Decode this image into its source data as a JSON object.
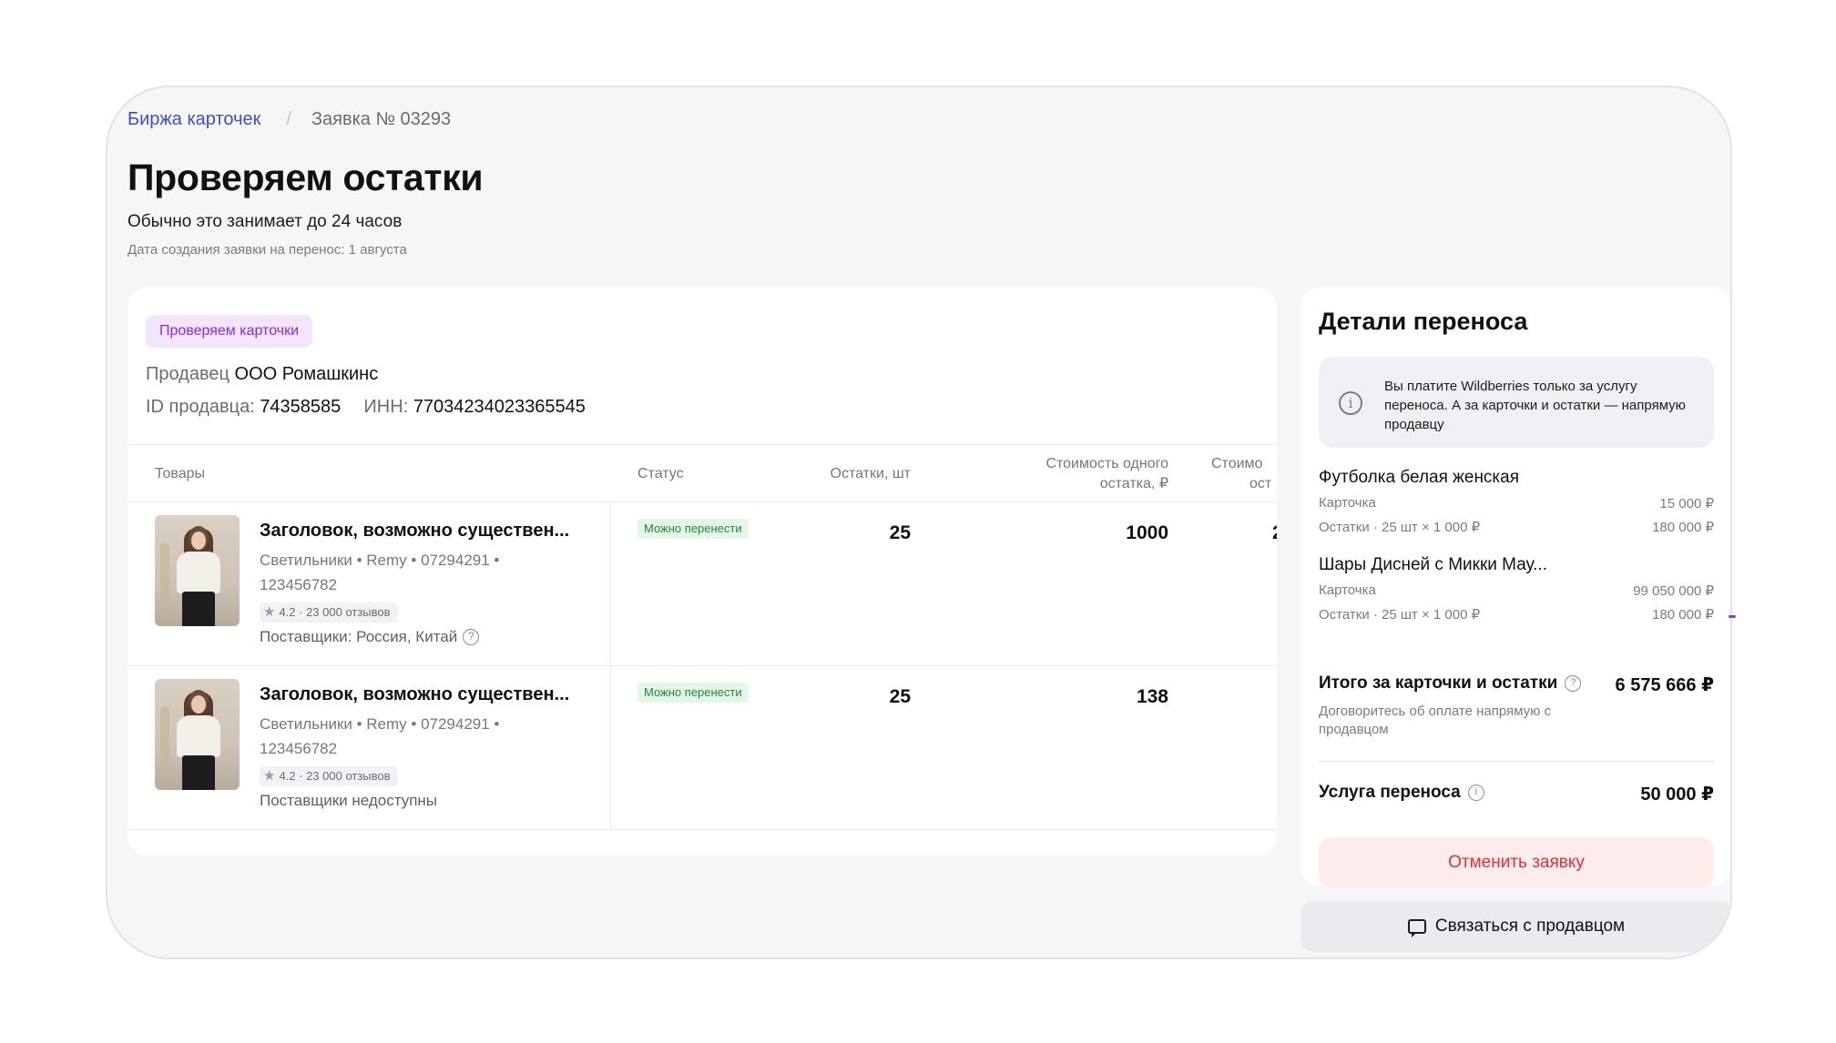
{
  "breadcrumb": {
    "link": "Биржа карточек",
    "separator": "/",
    "current": "Заявка № 03293"
  },
  "page": {
    "title": "Проверяем остатки",
    "subtitle": "Обычно это занимает до 24 часов",
    "created": "Дата создания заявки на перенос: 1 августа"
  },
  "seller": {
    "status_chip": "Проверяем карточки",
    "seller_label": "Продавец",
    "seller_name": "ООО Ромашкинс",
    "id_label": "ID продавца:",
    "id_value": "74358585",
    "inn_label": "ИНН:",
    "inn_value": "77034234023365545"
  },
  "table": {
    "headers": {
      "goods": "Товары",
      "status": "Статус",
      "stock": "Остатки, шт",
      "unit_cost_1": "Стоимость одного",
      "unit_cost_2": "остатка, ₽",
      "total_1": "Стоимо",
      "total_2": "ост"
    },
    "rows": [
      {
        "title": "Заголовок, возможно существен...",
        "meta": "Светильники • Remy • 07294291 • 123456782",
        "rating": "4.2 · 23 000 отзывов",
        "suppliers": "Поставщики: Россия, Китай",
        "status": "Можно перенести",
        "stock": "25",
        "unit_cost": "1000",
        "total": "2"
      },
      {
        "title": "Заголовок, возможно существен...",
        "meta": "Светильники • Remy • 07294291 • 123456782",
        "rating": "4.2 · 23 000 отзывов",
        "suppliers": "Поставщики недоступны",
        "status": "Можно перенести",
        "stock": "25",
        "unit_cost": "138",
        "total": ""
      }
    ]
  },
  "details": {
    "title": "Детали переноса",
    "info": "Вы платите Wildberries только за услугу переноса. А за карточки и остатки — напрямую продавцу",
    "items": [
      {
        "name": "Футболка белая женская",
        "card_label": "Карточка",
        "card_value": "15 000 ₽",
        "stock_label": "Остатки · 25 шт × 1 000 ₽",
        "stock_value": "180 000 ₽"
      },
      {
        "name": "Шары Дисней с Микки Мау...",
        "card_label": "Карточка",
        "card_value": "99 050 000 ₽",
        "stock_label": "Остатки · 25 шт × 1 000 ₽",
        "stock_value": "180 000 ₽"
      }
    ],
    "total_label": "Итого за карточки и остатки",
    "total_value": "6 575 666 ₽",
    "total_note": "Договоритесь об оплате напрямую с продавцом",
    "fee_label": "Услуга переноса",
    "fee_value": "50 000 ₽",
    "cancel_button": "Отменить заявку",
    "contact_button": "Связаться с продавцом"
  },
  "icons": {
    "info": "info-icon",
    "question": "question-icon",
    "star": "star-icon",
    "chat": "chat-icon"
  },
  "colors": {
    "link": "#3d4fc8",
    "chip_bg": "#f3e5fd",
    "chip_text": "#8a2be2",
    "ok_bg": "#e3f6e7",
    "ok_text": "#1f8a3a",
    "danger": "#e0313a"
  }
}
